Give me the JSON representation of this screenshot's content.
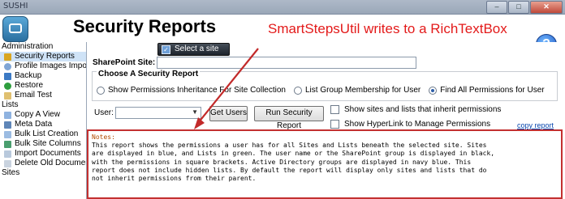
{
  "window": {
    "title": "SUSHI",
    "minimize_glyph": "–",
    "maximize_glyph": "□",
    "close_glyph": "✕"
  },
  "header": {
    "title": "Security Reports",
    "annotation": "SmartStepsUtil writes to a RichTextBox",
    "help_glyph": "?"
  },
  "colors": {
    "annotation": "#e31a1a",
    "notes_border": "#c33030",
    "selected_item": "#cfe3f7"
  },
  "sidebar": {
    "groups": [
      {
        "label": "Administration",
        "items": [
          {
            "label": "Security Reports",
            "icon": "key-icon",
            "selected": true
          },
          {
            "label": "Profile Images Import",
            "icon": "user-icon"
          },
          {
            "label": "Backup",
            "icon": "backup-icon"
          },
          {
            "label": "Restore",
            "icon": "restore-icon"
          },
          {
            "label": "Email Test",
            "icon": "email-icon"
          }
        ]
      },
      {
        "label": "Lists",
        "items": [
          {
            "label": "Copy A View",
            "icon": "copy-icon"
          },
          {
            "label": "Meta Data",
            "icon": "data-icon"
          },
          {
            "label": "Bulk List Creation",
            "icon": "list-icon"
          },
          {
            "label": "Bulk Site Columns",
            "icon": "columns-icon"
          },
          {
            "label": "Import Documents",
            "icon": "import-icon"
          },
          {
            "label": "Delete Old Documents",
            "icon": "delete-icon"
          }
        ]
      },
      {
        "label": "Sites",
        "items": []
      }
    ]
  },
  "main": {
    "select_site_label": "Select a site",
    "sharepoint_site_label": "SharePoint Site:",
    "sharepoint_site_value": "",
    "report_group_label": "Choose A Security Report",
    "report_options": [
      {
        "label": "Show Permissions Inheritance For Site Collection",
        "checked": false
      },
      {
        "label": "List Group Membership for User",
        "checked": false
      },
      {
        "label": "Find All Permissions for User",
        "checked": true
      }
    ],
    "user_label": "User:",
    "user_value": "",
    "get_users_label": "Get Users",
    "run_report_label": "Run Security Report",
    "option_inherit_label": "Show sites and lists that inherit permissions",
    "option_hyperlink_label": "Show HyperLink to Manage Permissions",
    "copy_report_label": "copy report",
    "notes_title": "Notes:",
    "notes_text": "This report shows the permissions a user has for all Sites and Lists beneath the selected site. Sites\nare displayed in blue, and Lists in green. The user name or the SharePoint group is displayed in black,\nwith the permissions in square brackets. Active Directory groups are displayed in navy blue. This\nreport does not include hidden lists. By default the report will display only sites and lists that do\nnot inherit permissions from their parent."
  }
}
